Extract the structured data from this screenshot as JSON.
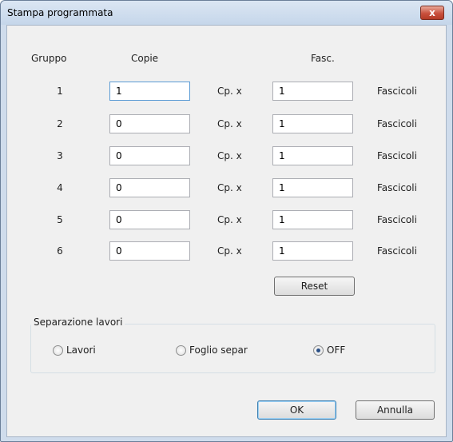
{
  "window": {
    "title": "Stampa programmata",
    "close_label": "x"
  },
  "headers": {
    "group": "Gruppo",
    "copies": "Copie",
    "sets": "Fasc."
  },
  "rows": [
    {
      "group": "1",
      "copies": "1",
      "cp_label": "Cp. x",
      "sets": "1",
      "sets_label": "Fascicoli"
    },
    {
      "group": "2",
      "copies": "0",
      "cp_label": "Cp. x",
      "sets": "1",
      "sets_label": "Fascicoli"
    },
    {
      "group": "3",
      "copies": "0",
      "cp_label": "Cp. x",
      "sets": "1",
      "sets_label": "Fascicoli"
    },
    {
      "group": "4",
      "copies": "0",
      "cp_label": "Cp. x",
      "sets": "1",
      "sets_label": "Fascicoli"
    },
    {
      "group": "5",
      "copies": "0",
      "cp_label": "Cp. x",
      "sets": "1",
      "sets_label": "Fascicoli"
    },
    {
      "group": "6",
      "copies": "0",
      "cp_label": "Cp. x",
      "sets": "1",
      "sets_label": "Fascicoli"
    }
  ],
  "reset_label": "Reset",
  "separation": {
    "label": "Separazione lavori",
    "options": [
      {
        "label": "Lavori",
        "checked": false
      },
      {
        "label": "Foglio separ",
        "checked": false
      },
      {
        "label": "OFF",
        "checked": true
      }
    ]
  },
  "buttons": {
    "ok": "OK",
    "cancel": "Annulla"
  }
}
